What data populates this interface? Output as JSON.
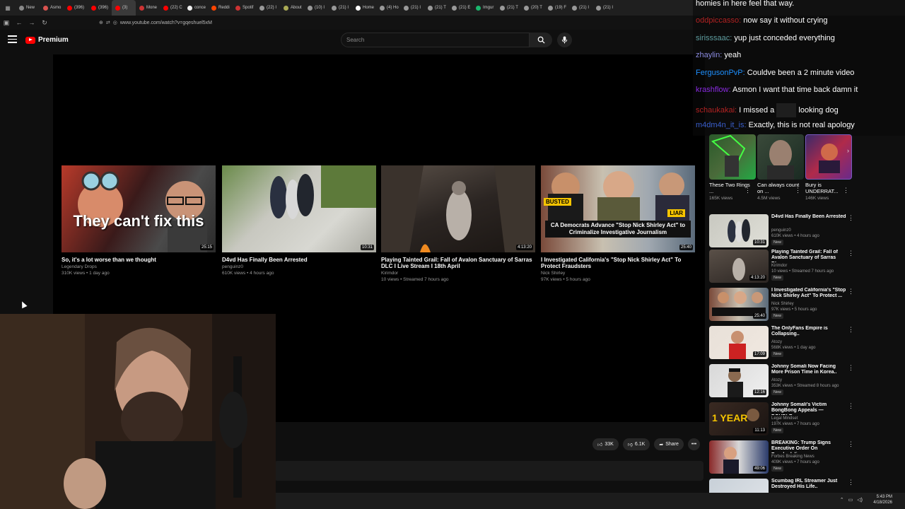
{
  "browser": {
    "tabs": [
      "New",
      "Asmo",
      "(396)",
      "(396)",
      "(3)",
      "Mone",
      "(22) C",
      "conce",
      "Reddi",
      "Spotif",
      "(22) I",
      "About",
      "(10) I",
      "(21) I",
      "Home",
      "(4) Ho",
      "(21) I",
      "(21) T",
      "(21) E",
      "Imgur",
      "(21) T",
      "(20) T",
      "(19) F",
      "(21) I",
      "(21) I"
    ],
    "active_tab_index": 4,
    "url": "www.youtube.com/watch?v=gqeshuel5xM"
  },
  "masthead": {
    "logo_text": "Premium",
    "search_placeholder": "Search"
  },
  "end_screen": [
    {
      "title": "So, it's a lot worse than we thought",
      "channel": "Legendary Drops",
      "stats": "310K views • 1 day ago",
      "duration": "25:15",
      "overlay": "They can't fix this"
    },
    {
      "title": "D4vd Has Finally Been Arrested",
      "channel": "penguinz0",
      "stats": "610K views • 4 hours ago",
      "duration": "10:31"
    },
    {
      "title": "Playing Tainted Grail: Fall of Avalon Sanctuary of Sarras DLC I Live Stream I 18th April",
      "channel": "Kirimdor",
      "stats": "10 views • Streamed 7 hours ago",
      "duration": "4:13:20"
    },
    {
      "title": "I Investigated California's \"Stop Nick Shirley Act\" To Protect Fraudsters",
      "channel": "Nick Shirley",
      "stats": "97K views • 5 hours ago",
      "duration": "25:40",
      "tag_left": "BUSTED",
      "tag_right": "LIAR",
      "caption": "CA Democrats Advance \"Stop Nick Shirley Act\" to Criminalize Investigative Journalism"
    }
  ],
  "actions": {
    "likes": "33K",
    "dislikes": "6.1K",
    "share": "Share"
  },
  "chat": [
    {
      "user": "",
      "message": "homies in here feel that way.",
      "color": "#ffffff"
    },
    {
      "user": "oddpiccasso:",
      "message": "now say it without crying",
      "color": "#b22222"
    },
    {
      "user": "sirisssaac:",
      "message": "yup just conceded everything",
      "color": "#5f9ea0"
    },
    {
      "user": "zhaylin:",
      "message": "yeah",
      "color": "#8a8adf"
    },
    {
      "user": "FergusonPvP:",
      "message": "Couldve been a 2 minute video",
      "color": "#1e90ff"
    },
    {
      "user": "krashflow:",
      "message": "Asmon I want that time back damn it",
      "color": "#8a2be2"
    },
    {
      "user": "schaukakai:",
      "message": "I missed a",
      "message2": "looking dog",
      "color": "#b22222"
    },
    {
      "user": "m4dm4n_it_is:",
      "message": "Exactly, this is not real apology",
      "color": "#3a5fcd"
    }
  ],
  "chip_cards": [
    {
      "title": "These Two Rings ...",
      "stats": "165K views"
    },
    {
      "title": "Can always count on ...",
      "stats": "4.5M views"
    },
    {
      "title": "Bury is UNDERRAT...",
      "stats": "146K views"
    }
  ],
  "recommendations": [
    {
      "title": "D4vd Has Finally Been Arrested",
      "channel": "penguinz0",
      "stats": "610K views • 4 hours ago",
      "badge": "New",
      "duration": "10:31"
    },
    {
      "title": "Playing Tainted Grail: Fall of Avalon Sanctuary of Sarras DL...",
      "channel": "Kirimdor",
      "stats": "10 views • Streamed 7 hours ago",
      "badge": "New",
      "duration": "4:13:20"
    },
    {
      "title": "I Investigated California's \"Stop Nick Shirley Act\" To Protect ...",
      "channel": "Nick Shirley",
      "stats": "97K views • 5 hours ago",
      "badge": "New",
      "duration": "25:40"
    },
    {
      "title": "The OnlyFans Empire is Collapsing..",
      "channel": "Atozy",
      "stats": "568K views • 1 day ago",
      "badge": "New",
      "duration": "17:09"
    },
    {
      "title": "Johnny Somali Now Facing More Prison Time in Korea..",
      "channel": "Atozy",
      "stats": "353K views • Streamed 8 hours ago",
      "badge": "New",
      "duration": "12:16"
    },
    {
      "title": "Johnny Somali's Victim BongBong Appeals — DOUBLE...",
      "channel": "Legal Mindset",
      "stats": "197K views • 7 hours ago",
      "badge": "New",
      "duration": "11:13",
      "overlay": "1 YEAR"
    },
    {
      "title": "BREAKING: Trump Signs Executive Order On Psychedeli...",
      "channel": "Forbes Breaking News",
      "stats": "409K views • 7 hours ago",
      "badge": "New",
      "duration": "49:06"
    },
    {
      "title": "Scumbag IRL Streamer Just Destroyed His Life..",
      "channel": "",
      "stats": "",
      "badge": "",
      "duration": ""
    }
  ],
  "taskbar": {
    "time": "5:43 PM",
    "date": "4/18/2026"
  }
}
